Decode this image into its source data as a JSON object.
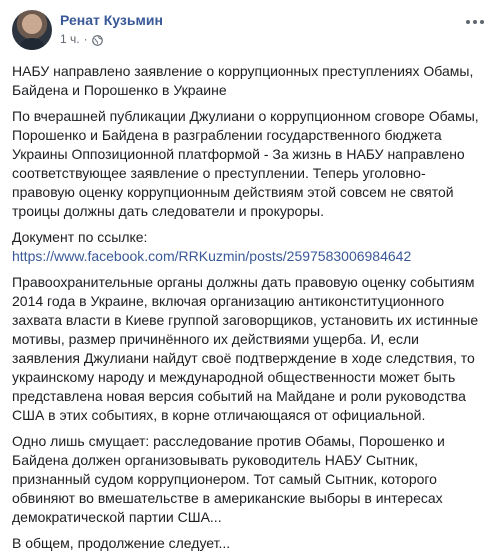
{
  "post": {
    "author": "Ренат Кузьмин",
    "time": "1 ч.",
    "separator": "·",
    "privacy_icon": "globe-icon",
    "paragraphs": [
      "НАБУ направлено заявление о коррупционных преступлениях Обамы, Байдена и Порошенко в Украине",
      "По вчерашней публикации Джулиани о коррупционном сговоре Обамы, Порошенко и Байдена в разграблении государственного бюджета Украины Оппозиционной платформой - За жизнь в НАБУ направлено соответствующее заявление о преступлении. Теперь уголовно-правовую оценку коррупционным действиям этой совсем не святой троицы должны дать следователи и прокуроры.",
      "Документ по ссылке:",
      "Правоохранительные органы должны дать правовую оценку событиям 2014 года в Украине, включая организацию антиконституционного захвата власти в Киеве группой заговорщиков, установить их истинные мотивы, размер причинённого их действиями ущерба. И, если заявления Джулиани найдут своё подтверждение в ходе следствия, то украинскому народу и международной общественности может быть представлена новая версия событий на Майдане и роли руководства США в этих событиях, в корне отличающаяся от официальной.",
      "Одно лишь смущает: расследование против Обамы, Порошенко и Байдена должен организовывать руководитель НАБУ Сытник, признанный судом коррупционером. Тот самый Сытник, которого обвиняют во вмешательстве в американские выборы в интересах демократической партии США...",
      "В общем, продолжение следует..."
    ],
    "link": "https://www.facebook.com/RRKuzmin/posts/2597583006984642"
  },
  "colors": {
    "link": "#385898",
    "text": "#1c1e21",
    "meta": "#606770"
  }
}
